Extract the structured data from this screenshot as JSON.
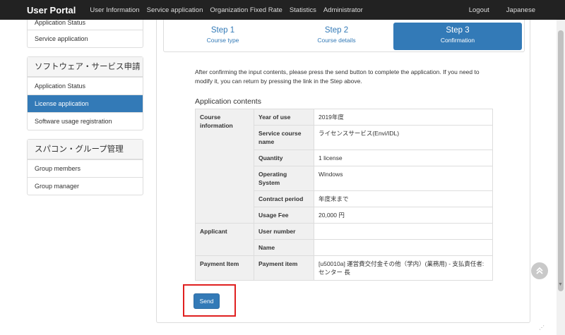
{
  "nav": {
    "brand": "User Portal",
    "items": [
      "User Information",
      "Service application",
      "Organization Fixed Rate",
      "Statistics",
      "Administrator"
    ],
    "right": [
      "Logout",
      "Japanese"
    ]
  },
  "sidebar": {
    "group1": [
      "Application Status",
      "Service application"
    ],
    "group2": {
      "title": "ソフトウェア・サービス申請",
      "items": [
        "Application Status",
        "License application",
        "Software usage registration"
      ]
    },
    "group3": {
      "title": "スパコン・グループ管理",
      "items": [
        "Group members",
        "Group manager"
      ]
    }
  },
  "steps": [
    {
      "title": "Step 1",
      "sub": "Course type"
    },
    {
      "title": "Step 2",
      "sub": "Course details"
    },
    {
      "title": "Step 3",
      "sub": "Confirmation"
    }
  ],
  "intro": "After confirming the input contents, please press the send button to complete the application. If you need to modify it, you can return by pressing the link in the Step above.",
  "section_title": "Application contents",
  "table": {
    "course_group": "Course information",
    "applicant_group": "Applicant",
    "payment_group": "Payment Item",
    "rows": [
      {
        "key": "Year of use",
        "value": "2019年度"
      },
      {
        "key": "Service course name",
        "value": "ライセンスサービス(Envi/IDL)"
      },
      {
        "key": "Quantity",
        "value": "1 license"
      },
      {
        "key": "Operating System",
        "value": "Windows"
      },
      {
        "key": "Contract period",
        "value": "年度末まで"
      },
      {
        "key": "Usage Fee",
        "value": "20,000 円"
      },
      {
        "key": "User number",
        "value": ""
      },
      {
        "key": "Name",
        "value": ""
      },
      {
        "key": "Payment item",
        "value": "[u50010a] 運営費交付金その他（学内）(業務用) - 支払責任者: センター 長"
      }
    ]
  },
  "send_label": "Send"
}
